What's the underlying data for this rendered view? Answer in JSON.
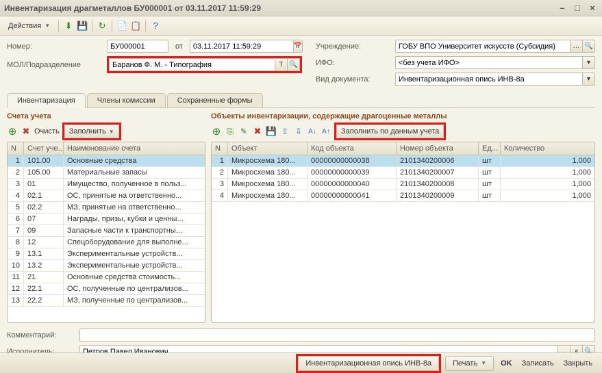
{
  "window": {
    "title": "Инвентаризация драгметаллов БУ000001 от 03.11.2017 11:59:29"
  },
  "toolbar": {
    "actions": "Действия"
  },
  "form": {
    "number_label": "Номер:",
    "number_value": "БУ000001",
    "from_label": "от",
    "date_value": "03.11.2017 11:59:29",
    "mol_label": "МОЛ/Подразделение",
    "mol_value": "Баранов Ф. М. - Типография",
    "institution_label": "Учреждение:",
    "institution_value": "ГОБУ ВПО Университет искусств (Субсидия)",
    "ifo_label": "ИФО:",
    "ifo_value": "<без учета ИФО>",
    "doctype_label": "Вид документа:",
    "doctype_value": "Инвентаризационная опись ИНВ-8а"
  },
  "tabs": {
    "inv": "Инвентаризация",
    "members": "Члены комиссии",
    "forms": "Сохраненные формы"
  },
  "leftPanel": {
    "title": "Счета учета",
    "clear": "Очисть",
    "fill": "Заполнить",
    "headers": {
      "n": "N",
      "acct": "Счет уче...",
      "name": "Наименование счета"
    },
    "rows": [
      {
        "n": "1",
        "acct": "101.00",
        "name": "Основные средства"
      },
      {
        "n": "2",
        "acct": "105.00",
        "name": "Материальные запасы"
      },
      {
        "n": "3",
        "acct": "01",
        "name": "Имущество, полученное в польз..."
      },
      {
        "n": "4",
        "acct": "02.1",
        "name": "ОС, принятые на ответственно..."
      },
      {
        "n": "5",
        "acct": "02.2",
        "name": "МЗ, принятые на ответственно..."
      },
      {
        "n": "6",
        "acct": "07",
        "name": "Награды, призы, кубки и ценны..."
      },
      {
        "n": "7",
        "acct": "09",
        "name": "Запасные части к транспортны..."
      },
      {
        "n": "8",
        "acct": "12",
        "name": "Спецоборудование для выполне..."
      },
      {
        "n": "9",
        "acct": "13.1",
        "name": "Экспериментальные устройств..."
      },
      {
        "n": "10",
        "acct": "13.2",
        "name": "Экспериментальные устройств..."
      },
      {
        "n": "11",
        "acct": "21",
        "name": "Основные средства стоимость..."
      },
      {
        "n": "12",
        "acct": "22.1",
        "name": "ОС, полученные по централизов..."
      },
      {
        "n": "13",
        "acct": "22.2",
        "name": "МЗ, полученные по централизов..."
      }
    ]
  },
  "rightPanel": {
    "title": "Объекты инвентаризации, содержащие драгоценные металлы",
    "fill": "Заполнить по данным учета",
    "headers": {
      "n": "N",
      "obj": "Объект",
      "code": "Код объекта",
      "num": "Номер объекта",
      "unit": "Ед...",
      "qty": "Количество"
    },
    "rows": [
      {
        "n": "1",
        "obj": "Микросхема 180...",
        "code": "00000000000038",
        "num": "2101340200006",
        "unit": "шт",
        "qty": "1,000"
      },
      {
        "n": "2",
        "obj": "Микросхема 180...",
        "code": "00000000000039",
        "num": "2101340200007",
        "unit": "шт",
        "qty": "1,000"
      },
      {
        "n": "3",
        "obj": "Микросхема 180...",
        "code": "00000000000040",
        "num": "2101340200008",
        "unit": "шт",
        "qty": "1,000"
      },
      {
        "n": "4",
        "obj": "Микросхема 180...",
        "code": "00000000000041",
        "num": "2101340200009",
        "unit": "шт",
        "qty": "1,000"
      }
    ]
  },
  "footer": {
    "comment_label": "Комментарий:",
    "comment_value": "",
    "performer_label": "Исполнитель:",
    "performer_value": "Петров Павел Иванович"
  },
  "bottom": {
    "inv_report": "Инвентаризационная опись ИНВ-8а",
    "print": "Печать",
    "ok": "OK",
    "save": "Записать",
    "close": "Закрыть"
  }
}
